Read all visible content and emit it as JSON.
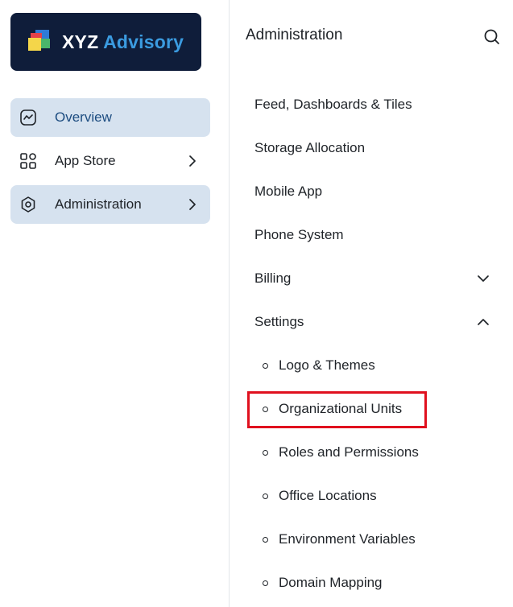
{
  "logo": {
    "word1": "XYZ",
    "word2": "Advisory"
  },
  "sidebar": {
    "items": [
      {
        "label": "Overview",
        "icon": "chart-icon",
        "state": "active"
      },
      {
        "label": "App Store",
        "icon": "apps-icon",
        "state": "normal"
      },
      {
        "label": "Administration",
        "icon": "gear-icon",
        "state": "expanded"
      }
    ]
  },
  "panel": {
    "title": "Administration",
    "search_icon": "search-icon",
    "items": [
      {
        "label": "Feed, Dashboards & Tiles"
      },
      {
        "label": "Storage Allocation"
      },
      {
        "label": "Mobile App"
      },
      {
        "label": "Phone System"
      },
      {
        "label": "Billing",
        "expandable": true,
        "expanded": false
      },
      {
        "label": "Settings",
        "expandable": true,
        "expanded": true
      }
    ],
    "settings_sub_items": [
      {
        "label": "Logo & Themes"
      },
      {
        "label": "Organizational Units",
        "highlighted": true
      },
      {
        "label": "Roles and Permissions"
      },
      {
        "label": "Office Locations"
      },
      {
        "label": "Environment Variables"
      },
      {
        "label": "Domain Mapping"
      }
    ]
  },
  "colors": {
    "logo_bg": "#0f1d3a",
    "brand_accent": "#3b9be0",
    "active_bg": "#d6e2ef",
    "active_text": "#1c4c80",
    "highlight": "#e0101e"
  }
}
